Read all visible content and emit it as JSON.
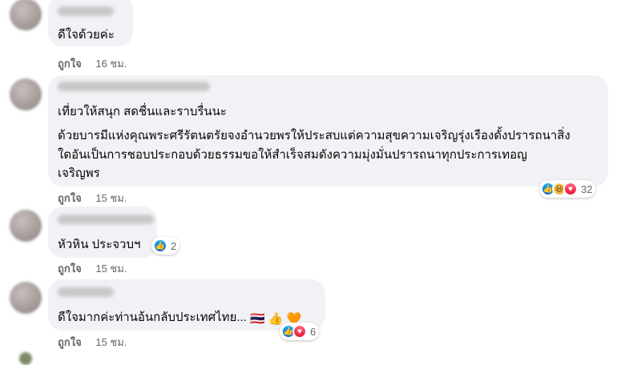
{
  "comments": [
    {
      "text": "ดีใจด้วยค่ะ",
      "like_label": "ถูกใจ",
      "time": "16 ชม."
    },
    {
      "lines": [
        "เที่ยวให้สนุก สดชื่นและราบรื่นนะ",
        "ด้วยบารมีแห่งคุณพระศรีรัตนตรัยจงอำนวยพรให้ประสบแต่ความสุขความเจริญรุ่งเรืองดั้งปรารถนาสิ่ง",
        "ใดอันเป็นการชอบประกอบด้วยธรรมขอให้สำเร็จสมดังความมุ่งมั่นปรารถนาทุกประการเทอญ",
        "เจริญพร"
      ],
      "like_label": "ถูกใจ",
      "time": "15 ชม.",
      "reactions": [
        "like-icon",
        "haha-icon",
        "love-icon"
      ],
      "reaction_count": "32"
    },
    {
      "text": "หัวหิน ประจวบฯ",
      "like_label": "ถูกใจ",
      "time": "15 ชม.",
      "reactions": [
        "like-icon"
      ],
      "reaction_count": "2"
    },
    {
      "text": "ดีใจมากค่ะท่านอ้นกลับประเทศไทย...",
      "emojis": [
        "🇹🇭",
        "👍",
        "🧡"
      ],
      "like_label": "ถูกใจ",
      "time": "15 ชม.",
      "reactions": [
        "like-icon",
        "love-icon"
      ],
      "reaction_count": "6"
    }
  ],
  "colors": {
    "bubble": "#f0f2f5",
    "meta": "#65676b",
    "like_blue": "#0062df",
    "love_red": "#e61739"
  }
}
